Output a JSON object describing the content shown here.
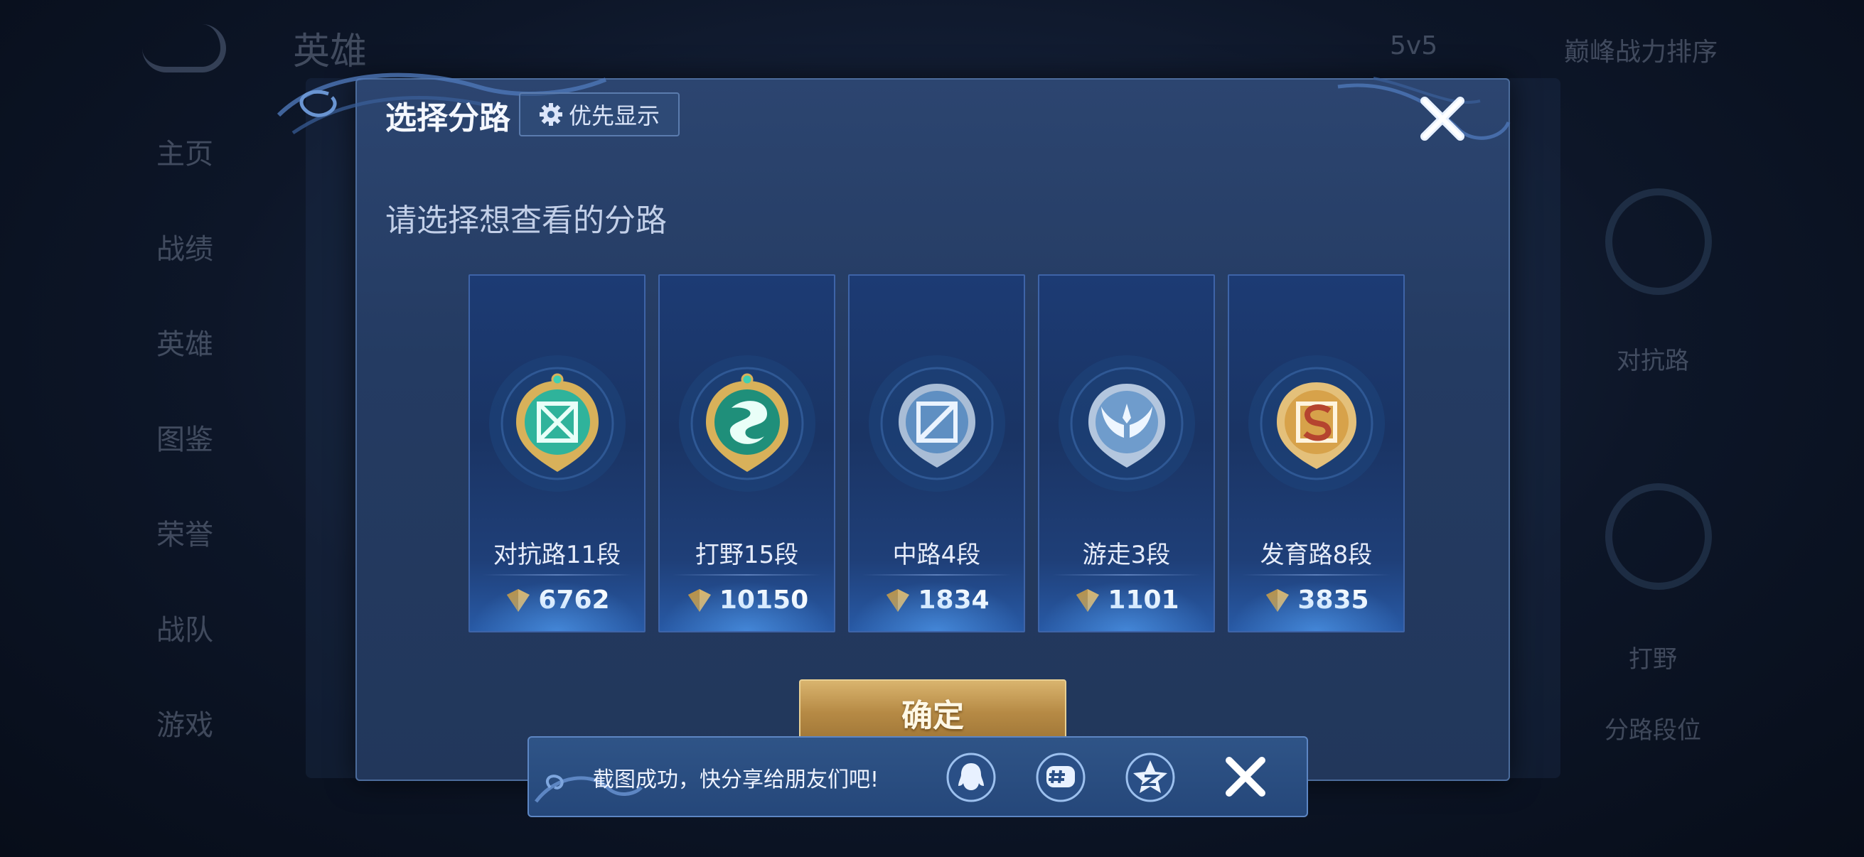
{
  "background": {
    "title": "英雄",
    "mode": "5v5",
    "sort": "巅峰战力排序",
    "sidebar": [
      "主页",
      "战绩",
      "英雄",
      "图鉴",
      "荣誉",
      "战队",
      "游戏"
    ],
    "right_labels": [
      "对抗路",
      "打野",
      "分路段位"
    ]
  },
  "modal": {
    "title": "选择分路",
    "priority_label": "优先显示",
    "subtitle": "请选择想查看的分路",
    "confirm_label": "确定",
    "lanes": [
      {
        "name": "对抗路11段",
        "score": "6762",
        "emblem": "clash-lane-emblem-icon",
        "color": "#2fb39b"
      },
      {
        "name": "打野15段",
        "score": "10150",
        "emblem": "jungle-dragon-emblem-icon",
        "color": "#1f8f7a"
      },
      {
        "name": "中路4段",
        "score": "1834",
        "emblem": "mid-lane-emblem-icon",
        "color": "#8fb4da"
      },
      {
        "name": "游走3段",
        "score": "1101",
        "emblem": "roam-wings-emblem-icon",
        "color": "#9fbfe0"
      },
      {
        "name": "发育路8段",
        "score": "3835",
        "emblem": "farm-lane-emblem-icon",
        "color": "#d7a24a"
      }
    ]
  },
  "toast": {
    "text": "截图成功，快分享给朋友们吧!",
    "share_targets": [
      "qq-icon",
      "wechat-moments-icon",
      "qzone-icon"
    ]
  },
  "colors": {
    "accent_gold": "#c9a05a",
    "panel_blue": "#243b62",
    "card_border": "#3e64a8"
  }
}
